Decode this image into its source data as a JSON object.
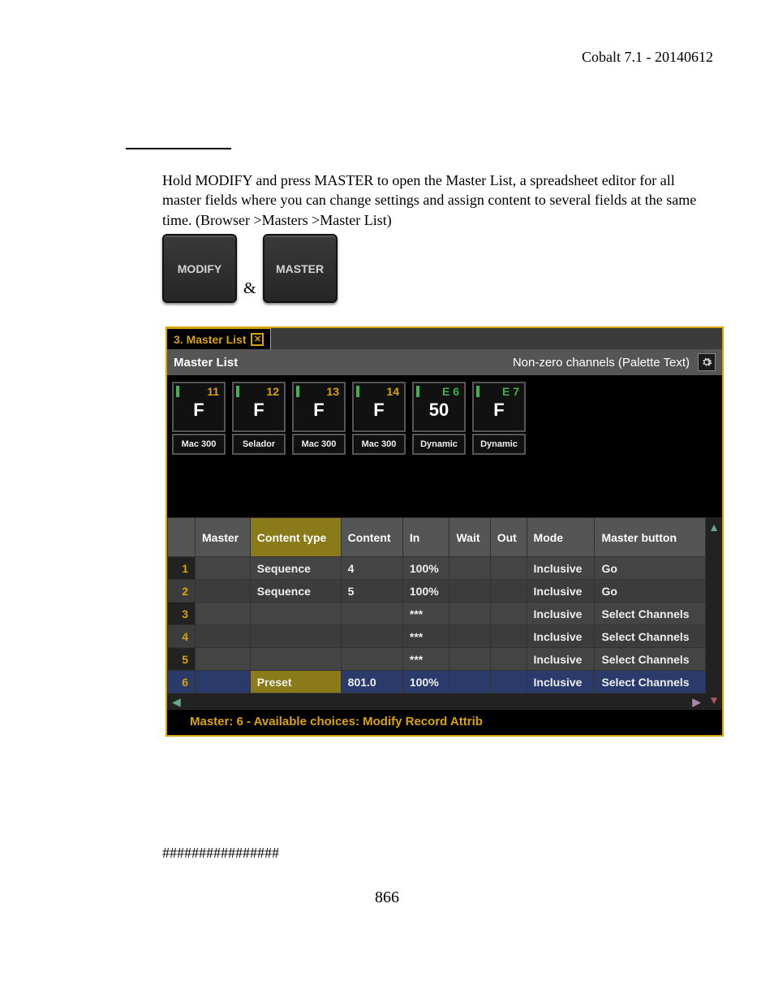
{
  "header": "Cobalt 7.1 - 20140612",
  "body_text": "Hold MODIFY and press MASTER to open the Master List, a spreadsheet editor for all master fields where you can change settings and assign content to several fields at the same time. (Browser >Masters >Master List)",
  "keys": {
    "modify": "MODIFY",
    "master": "MASTER",
    "amp": "&"
  },
  "tab": {
    "title": "3. Master List"
  },
  "subheader": {
    "left": "Master List",
    "right": "Non-zero channels (Palette Text)"
  },
  "masters": [
    {
      "num": "11",
      "numColor": "y",
      "big": "F",
      "label": "Mac 300"
    },
    {
      "num": "12",
      "numColor": "y",
      "big": "F",
      "label": "Selador"
    },
    {
      "num": "13",
      "numColor": "y",
      "big": "F",
      "label": "Mac 300"
    },
    {
      "num": "14",
      "numColor": "y",
      "big": "F",
      "label": "Mac 300"
    },
    {
      "num": "E 6",
      "numColor": "g",
      "big": "50",
      "label": "Dynamic"
    },
    {
      "num": "E 7",
      "numColor": "g",
      "big": "F",
      "label": "Dynamic"
    }
  ],
  "columns": [
    "",
    "Master",
    "Content type",
    "Content",
    "In",
    "Wait",
    "Out",
    "Mode",
    "Master button"
  ],
  "rows": [
    {
      "idx": "1",
      "ctype": "Sequence",
      "content": "4",
      "in": "100%",
      "wait": "",
      "out": "",
      "mode": "Inclusive",
      "mbtn": "Go"
    },
    {
      "idx": "2",
      "ctype": "Sequence",
      "content": "5",
      "in": "100%",
      "wait": "",
      "out": "",
      "mode": "Inclusive",
      "mbtn": "Go"
    },
    {
      "idx": "3",
      "ctype": "",
      "content": "",
      "in": "***",
      "wait": "",
      "out": "",
      "mode": "Inclusive",
      "mbtn": "Select Channels"
    },
    {
      "idx": "4",
      "ctype": "",
      "content": "",
      "in": "***",
      "wait": "",
      "out": "",
      "mode": "Inclusive",
      "mbtn": "Select Channels"
    },
    {
      "idx": "5",
      "ctype": "",
      "content": "",
      "in": "***",
      "wait": "",
      "out": "",
      "mode": "Inclusive",
      "mbtn": "Select Channels"
    },
    {
      "idx": "6",
      "ctype": "Preset",
      "content": "801.0",
      "in": "100%",
      "wait": "",
      "out": "",
      "mode": "Inclusive",
      "mbtn": "Select Channels"
    }
  ],
  "status": "Master: 6 - Available choices: Modify Record Attrib",
  "footer_hash": "################",
  "page_number": "866"
}
